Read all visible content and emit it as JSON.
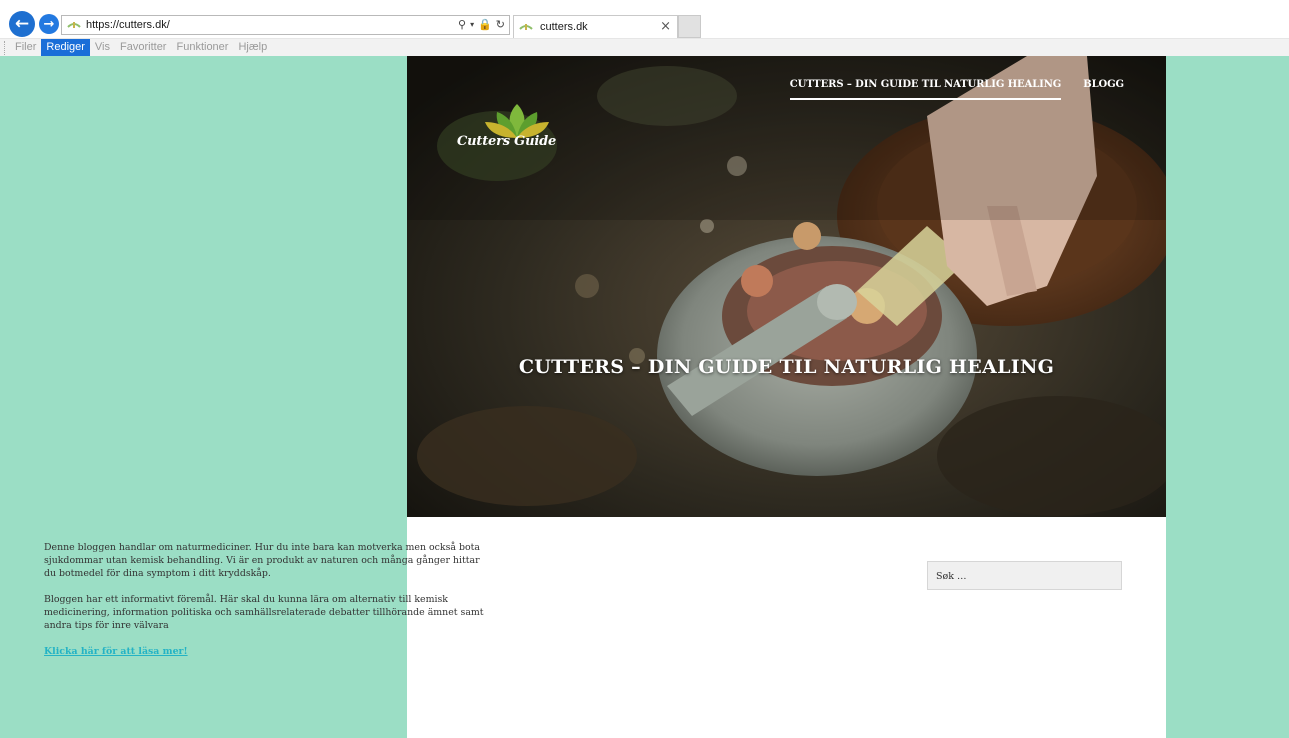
{
  "browser": {
    "url": "https://cutters.dk/",
    "tab_title": "cutters.dk",
    "tab_close": "×",
    "icons": [
      "back-arrow-icon",
      "forward-arrow-icon",
      "search-icon",
      "lock-icon",
      "refresh-icon"
    ],
    "menu": [
      "Filer",
      "Rediger",
      "Vis",
      "Favoritter",
      "Funktioner",
      "Hjælp"
    ],
    "accent": "#1a6ed8"
  },
  "site": {
    "logo_text": "Cutters Guide",
    "nav": [
      "CUTTERS – DIN GUIDE TIL NATURLIG HEALING",
      "BLOGG"
    ],
    "hero_title": "CUTTERS – DIN GUIDE TIL NATURLIG HEALING",
    "search_placeholder": "Søk …",
    "paragraphs": [
      "Denne bloggen handlar om naturmediciner. Hur du inte bara kan motverka men också bota sjukdommar utan kemisk behandling. Vi är en produkt av naturen och många gånger hittar du botmedel för dina symptom i ditt kryddskåp.",
      "Bloggen har ett informativt föremål. Här skal du kunna lära om alternativ till kemisk medicinering, information politiska och samhällsrelaterade debatter tillhörande ämnet samt andra tips för inre välvara"
    ],
    "read_more": "Klicka här för att läsa mer!",
    "background_color": "#9bdec5",
    "link_color": "#24b3c5"
  }
}
